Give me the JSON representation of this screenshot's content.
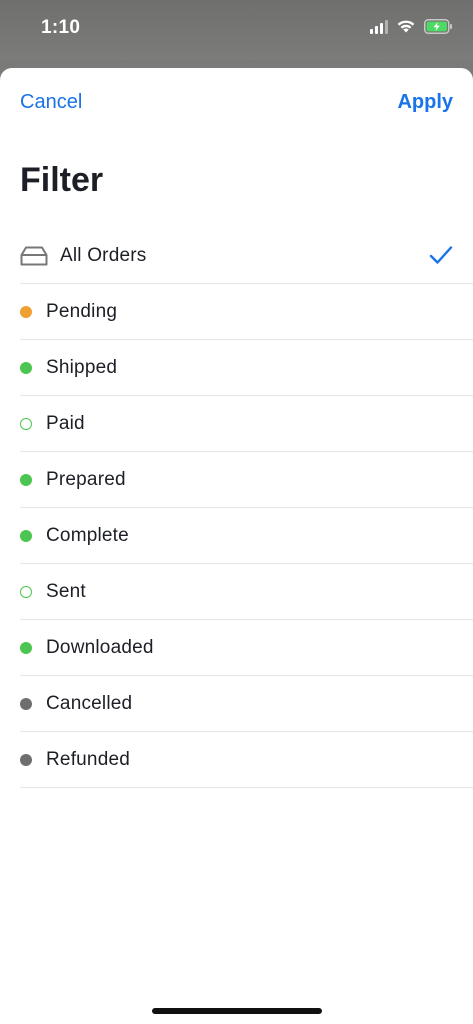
{
  "status_bar": {
    "time": "1:10",
    "icons": [
      "cellular-signal-icon",
      "wifi-icon",
      "battery-charging-icon"
    ]
  },
  "nav": {
    "cancel_label": "Cancel",
    "apply_label": "Apply"
  },
  "title": "Filter",
  "colors": {
    "accent": "#1a73e8",
    "pending": "#f0a030",
    "green": "#4cc552",
    "gray": "#6e6e6e"
  },
  "filters": [
    {
      "label": "All Orders",
      "icon": "inbox-tray-icon",
      "selected": true
    },
    {
      "label": "Pending",
      "dot": "filled",
      "color": "#f0a030"
    },
    {
      "label": "Shipped",
      "dot": "filled",
      "color": "#4cc552"
    },
    {
      "label": "Paid",
      "dot": "hollow",
      "color": "#4cc552"
    },
    {
      "label": "Prepared",
      "dot": "filled",
      "color": "#4cc552"
    },
    {
      "label": "Complete",
      "dot": "filled",
      "color": "#4cc552"
    },
    {
      "label": "Sent",
      "dot": "hollow",
      "color": "#4cc552"
    },
    {
      "label": "Downloaded",
      "dot": "filled",
      "color": "#4cc552"
    },
    {
      "label": "Cancelled",
      "dot": "filled",
      "color": "#6e6e6e"
    },
    {
      "label": "Refunded",
      "dot": "filled",
      "color": "#6e6e6e"
    }
  ]
}
